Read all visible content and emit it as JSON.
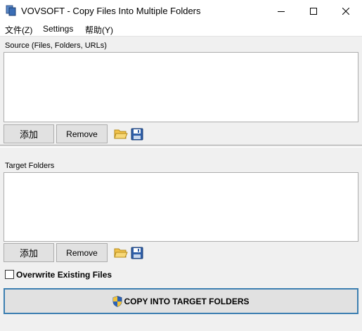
{
  "window": {
    "title": "VOVSOFT - Copy Files Into Multiple Folders",
    "app_icon": "copy-files-app-icon",
    "controls": [
      "minimize-icon",
      "maximize-icon",
      "close-icon"
    ]
  },
  "menu": {
    "items": [
      {
        "label": "文件(Z)"
      },
      {
        "label": "Settings"
      },
      {
        "label": "帮助(Y)"
      }
    ]
  },
  "source": {
    "label": "Source (Files, Folders, URLs)",
    "add_label": "添加",
    "remove_label": "Remove",
    "open_icon": "folder-open-icon",
    "save_icon": "floppy-save-icon"
  },
  "target": {
    "label": "Target Folders",
    "add_label": "添加",
    "remove_label": "Remove",
    "open_icon": "folder-open-icon",
    "save_icon": "floppy-save-icon"
  },
  "options": {
    "overwrite_label": "Overwrite Existing Files",
    "overwrite_checked": false
  },
  "action": {
    "copy_label": "COPY INTO TARGET FOLDERS",
    "shield_icon": "uac-shield-icon"
  },
  "colors": {
    "panel_bg": "#f0f0f0",
    "button_bg": "#e1e1e1",
    "accent_border": "#3c7fb1"
  }
}
